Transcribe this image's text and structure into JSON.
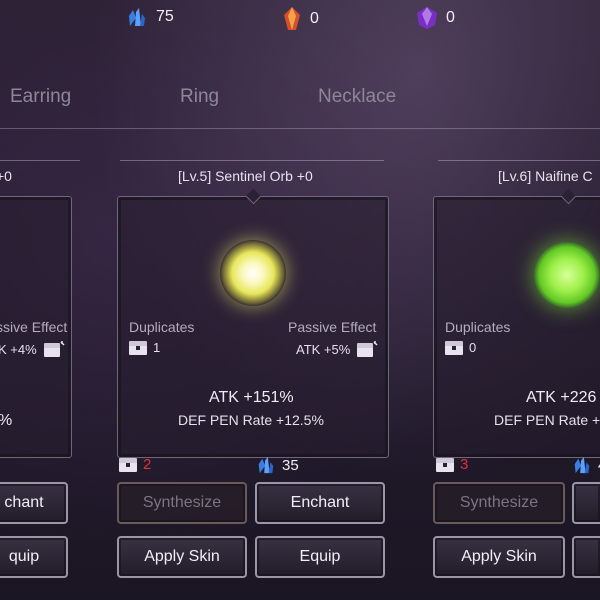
{
  "currencies": [
    {
      "icon": "blue-crystal-icon",
      "value": "75"
    },
    {
      "icon": "red-gem-icon",
      "value": "0"
    },
    {
      "icon": "purple-gem-icon",
      "value": "0"
    }
  ],
  "tabs": [
    "Earring",
    "Ring",
    "Necklace"
  ],
  "cards": [
    {
      "title": "+0",
      "passive_label": "ssive Effect",
      "passive_value": "K +4%",
      "stat1": "%",
      "btn_top": "chant",
      "btn_bottom": "quip"
    },
    {
      "title": "[Lv.5] Sentinel Orb +0",
      "duplicates_label": "Duplicates",
      "duplicates_value": "1",
      "passive_label": "Passive Effect",
      "passive_value": "ATK +5%",
      "stat1": "ATK +151%",
      "stat2": "DEF PEN Rate +12.5%",
      "cost_chest": "2",
      "cost_crystal": "35",
      "synthesize": "Synthesize",
      "enchant": "Enchant",
      "apply_skin": "Apply Skin",
      "equip": "Equip"
    },
    {
      "title": "[Lv.6] Naifine C",
      "duplicates_label": "Duplicates",
      "duplicates_value": "0",
      "stat1": "ATK +226",
      "stat2": "DEF PEN Rate +",
      "cost_chest": "3",
      "cost_crystal": "4",
      "synthesize": "Synthesize",
      "apply_skin": "Apply Skin"
    }
  ],
  "colors": {
    "accent_red": "#e0303a",
    "crystal_blue": "#3a7fe0",
    "orb_yellow": "#f2f07a",
    "orb_green": "#8ae83a"
  }
}
